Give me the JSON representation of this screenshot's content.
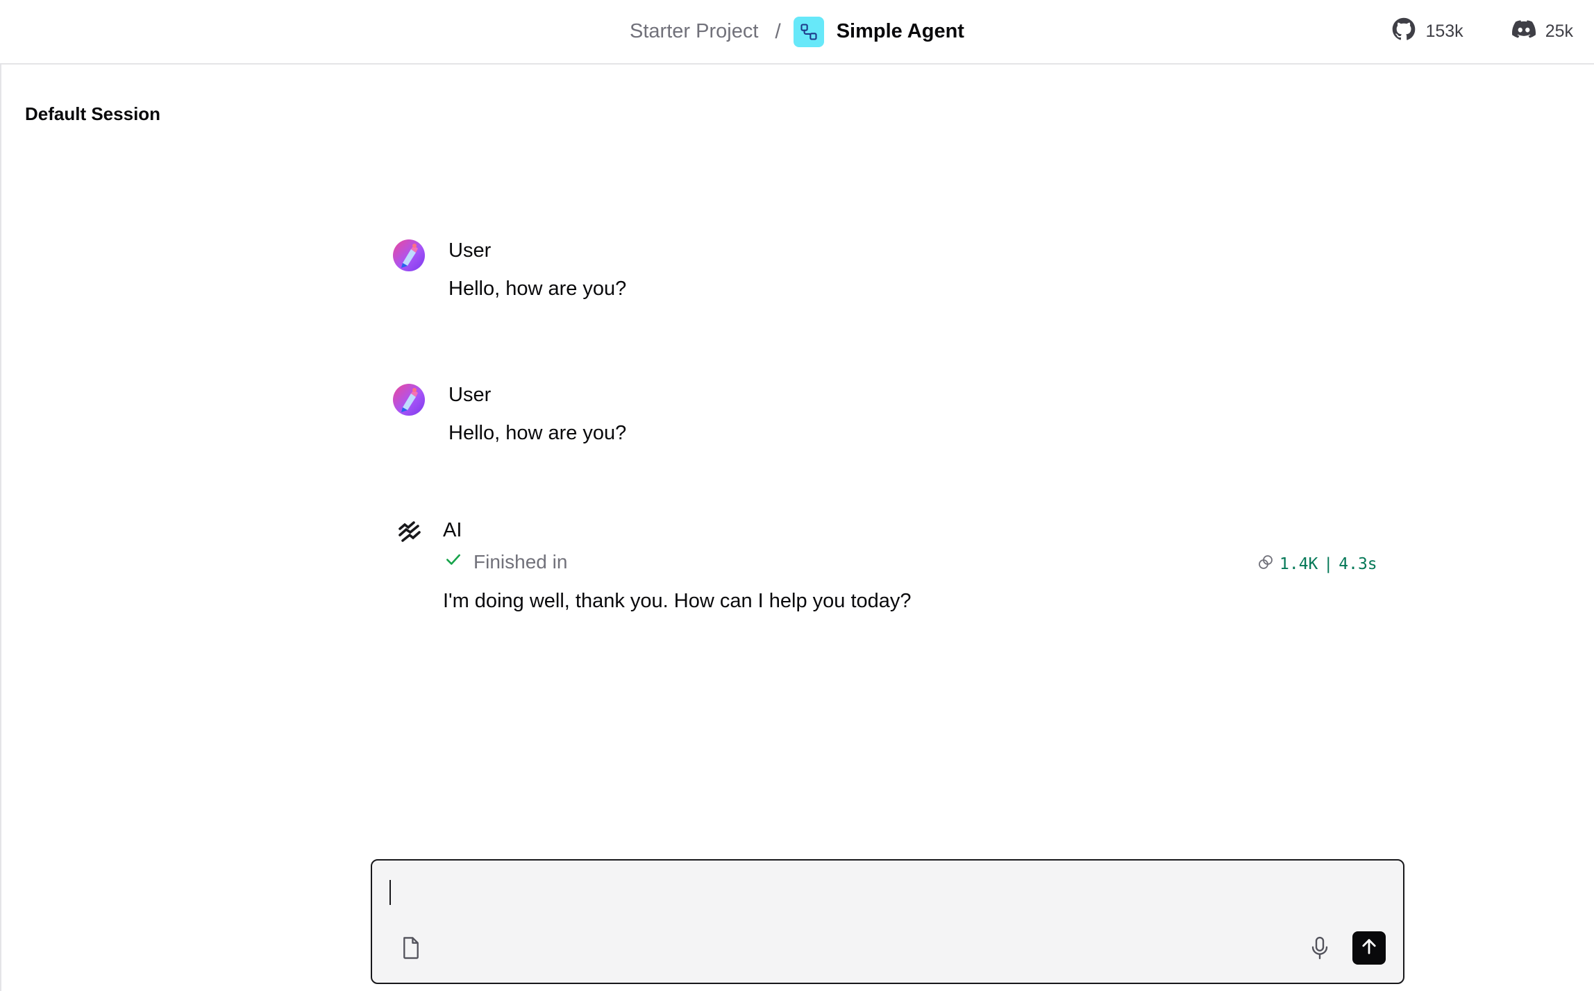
{
  "header": {
    "project_name": "Starter Project",
    "separator": "/",
    "flow_name": "Simple Agent",
    "flow_icon": "flow-icon",
    "github": {
      "icon": "github-icon",
      "count": "153k"
    },
    "discord": {
      "icon": "discord-icon",
      "count": "25k"
    }
  },
  "session": {
    "title": "Default Session"
  },
  "messages": [
    {
      "sender": "User",
      "avatar": "user-avatar",
      "text": "Hello, how are you?"
    },
    {
      "sender": "User",
      "avatar": "user-avatar",
      "text": "Hello, how are you?"
    },
    {
      "sender": "AI",
      "avatar": "ai-logo-icon",
      "status": "Finished in",
      "tokens": "1.4K",
      "meta_separator": "|",
      "duration": "4.3s",
      "text": "I'm doing well, thank you. How can I help you today?"
    }
  ],
  "input": {
    "value": "",
    "placeholder": ""
  },
  "colors": {
    "accent_flow_icon": "#67e8f9",
    "status_check": "#16a34a",
    "meta_text": "#047857",
    "send_button": "#09090b",
    "input_background": "#f4f4f5"
  }
}
